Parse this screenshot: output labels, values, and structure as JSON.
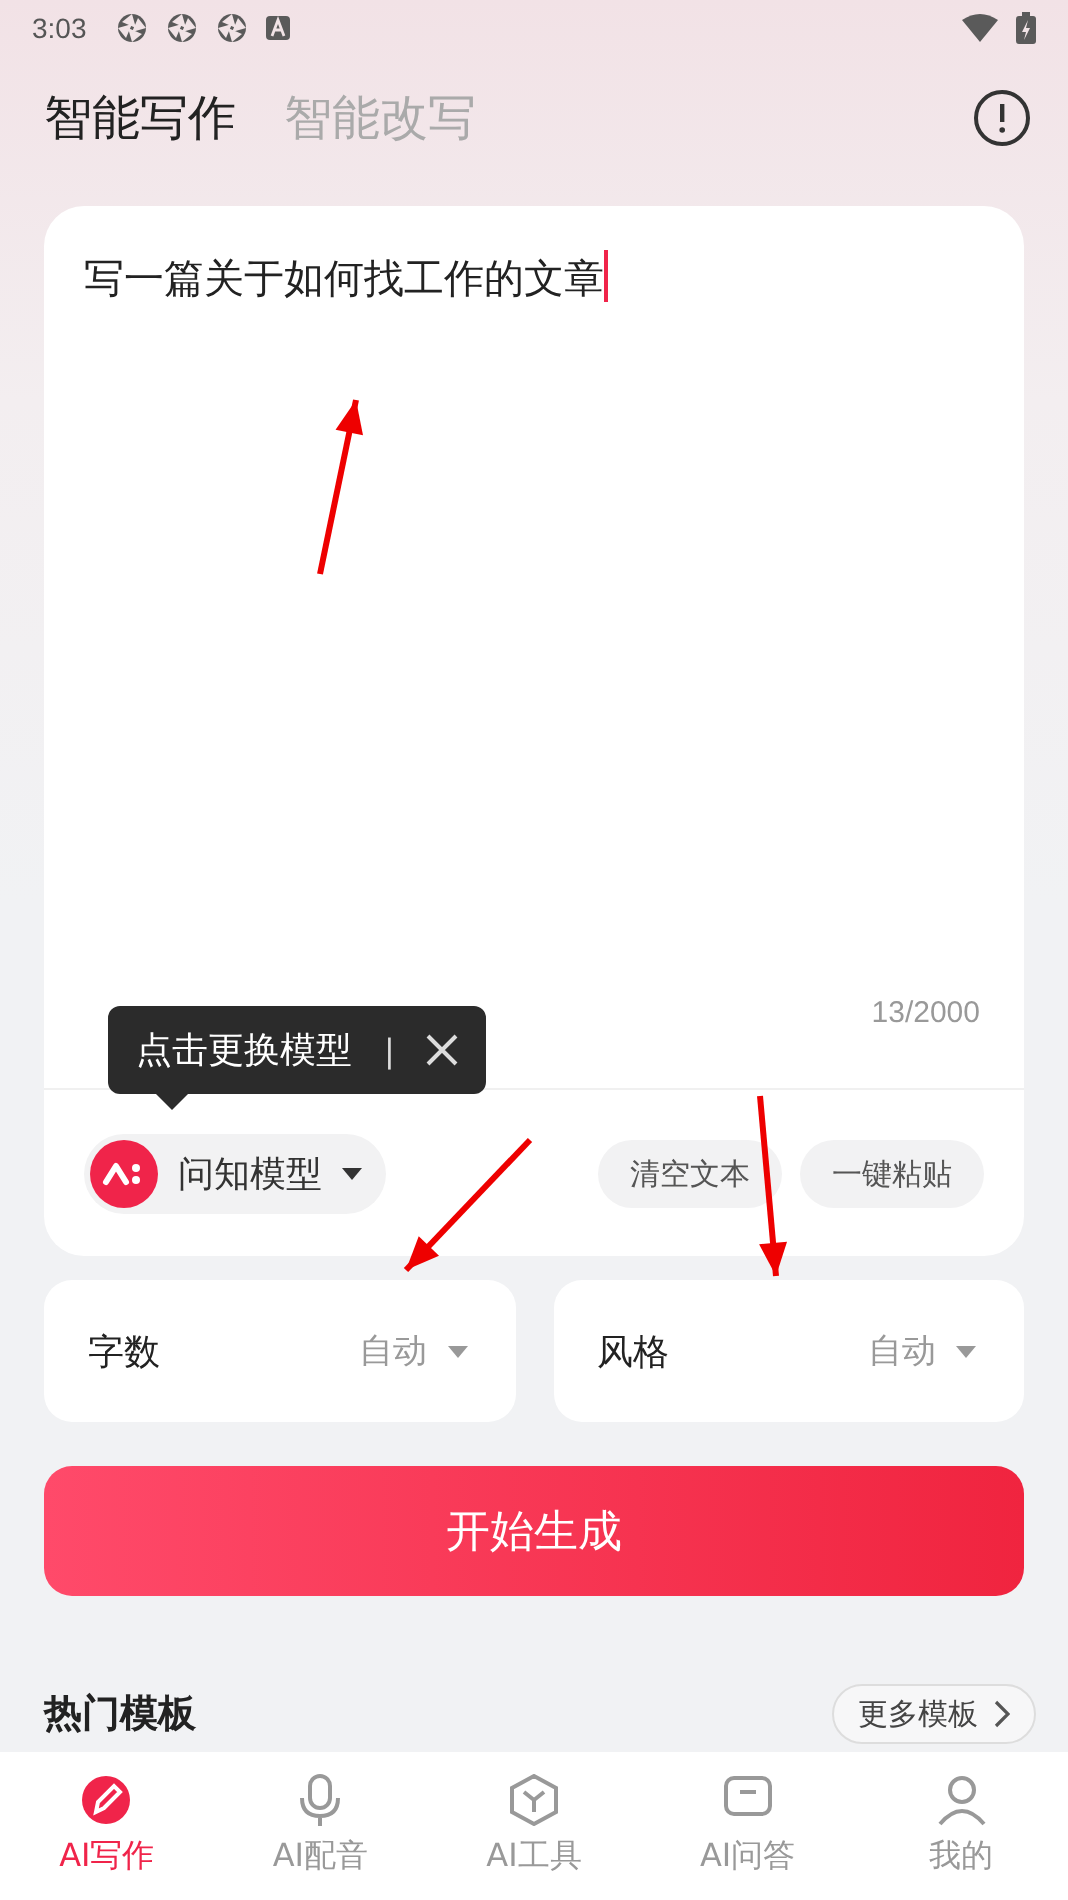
{
  "status_bar": {
    "time": "3:03"
  },
  "tabs": [
    {
      "label": "智能写作",
      "selected": true
    },
    {
      "label": "智能改写",
      "selected": false
    }
  ],
  "editor": {
    "value": "写一篇关于如何找工作的文章",
    "counter": "13/2000"
  },
  "tooltip": {
    "text": "点击更换模型",
    "separator": "|"
  },
  "model": {
    "label": "问知模型"
  },
  "actions": [
    "清空文本",
    "一键粘贴"
  ],
  "options": [
    {
      "label": "字数",
      "value": "自动"
    },
    {
      "label": "风格",
      "value": "自动"
    }
  ],
  "generate_button": "开始生成",
  "templates": {
    "title": "热门模板",
    "more": "更多模板"
  },
  "nav": [
    {
      "label": "AI写作",
      "selected": true
    },
    {
      "label": "AI配音",
      "selected": false
    },
    {
      "label": "AI工具",
      "selected": false
    },
    {
      "label": "AI问答",
      "selected": false
    },
    {
      "label": "我的",
      "selected": false
    }
  ]
}
